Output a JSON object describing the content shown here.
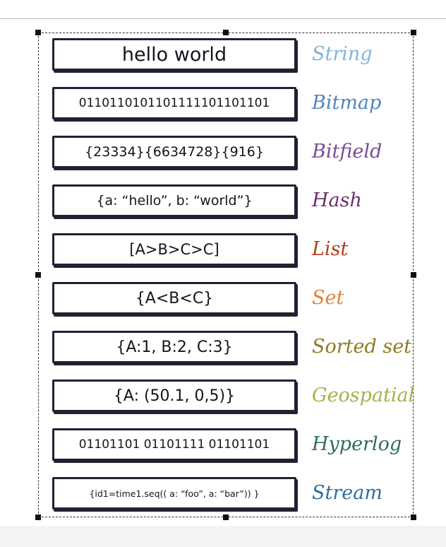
{
  "rows": [
    {
      "value": "hello world",
      "label": "String",
      "color": "#7fb6d9"
    },
    {
      "value": "0110110101101111101101101",
      "label": "Bitmap",
      "color": "#4d86bf"
    },
    {
      "value": "{23334}{6634728}{916}",
      "label": "Bitfield",
      "color": "#7a4b96"
    },
    {
      "value": "{a: “hello”, b: “world”}",
      "label": "Hash",
      "color": "#6b2f6d"
    },
    {
      "value": "[A>B>C>C]",
      "label": "List",
      "color": "#b23f1c"
    },
    {
      "value": "{A<B<C}",
      "label": "Set",
      "color": "#e0843d"
    },
    {
      "value": "{A:1, B:2, C:3}",
      "label": "Sorted set",
      "color": "#8f7a22"
    },
    {
      "value": "{A: (50.1, 0,5)}",
      "label": "Geospatial",
      "color": "#9db64a"
    },
    {
      "value": "01101101 01101111 01101101",
      "label": "Hyperlog",
      "color": "#2f6e5a"
    },
    {
      "value": "{id1=time1.seq(( a: “foo”, a: “bar”)) }",
      "label": "Stream",
      "color": "#2f6fa0"
    }
  ]
}
